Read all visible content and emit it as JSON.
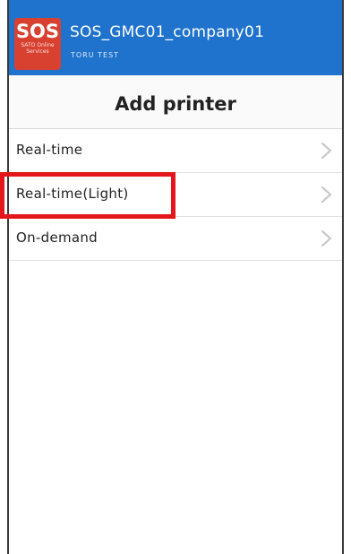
{
  "header": {
    "logo_text": "SOS",
    "logo_subtext": "SATO Online Services",
    "company_name": "SOS_GMC01_company01",
    "user_name": "TORU TEST"
  },
  "page": {
    "title": "Add printer"
  },
  "menu": {
    "items": [
      {
        "label": "Real-time",
        "icon": "chevron-right-icon"
      },
      {
        "label": "Real-time(Light)",
        "icon": "chevron-right-icon",
        "highlighted": true
      },
      {
        "label": "On-demand",
        "icon": "chevron-right-icon"
      }
    ]
  },
  "colors": {
    "header_bg": "#1f73cc",
    "logo_bg": "#d8402f",
    "highlight": "#e3161b"
  }
}
